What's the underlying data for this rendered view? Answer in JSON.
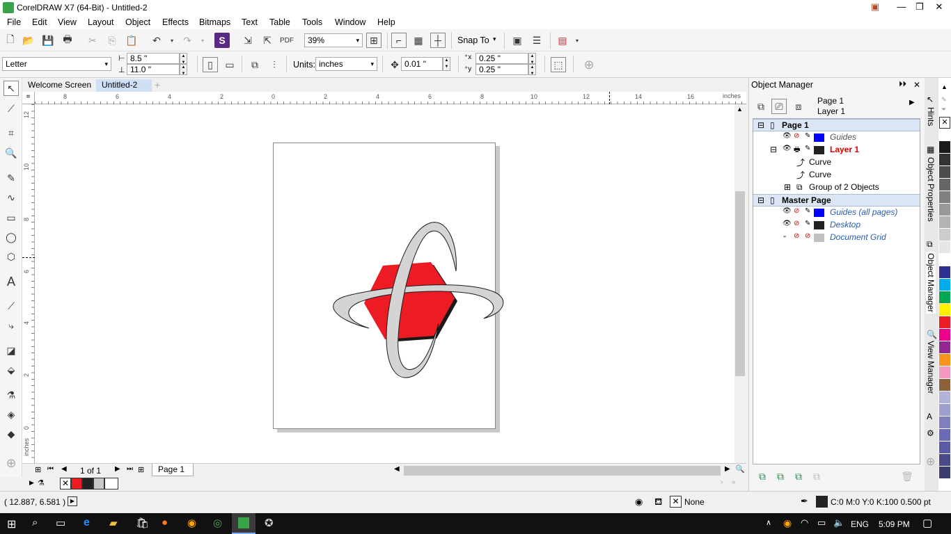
{
  "window": {
    "title": "CorelDRAW X7 (64-Bit) - Untitled-2"
  },
  "menu": [
    "File",
    "Edit",
    "View",
    "Layout",
    "Object",
    "Effects",
    "Bitmaps",
    "Text",
    "Table",
    "Tools",
    "Window",
    "Help"
  ],
  "toolbar": {
    "zoom": "39%",
    "snap_to": "Snap To"
  },
  "property_bar": {
    "page_size": "Letter",
    "width": "8.5 \"",
    "height": "11.0 \"",
    "units_label": "Units:",
    "units": "inches",
    "nudge": "0.01 \"",
    "dup_x": "0.25 \"",
    "dup_y": "0.25 \""
  },
  "doc_tabs": [
    "Welcome Screen",
    "Untitled-2"
  ],
  "ruler": {
    "h_labels": [
      "8",
      "6",
      "4",
      "2",
      "0",
      "2",
      "4",
      "6",
      "8",
      "10",
      "12",
      "14",
      "16"
    ],
    "h_unit": "inches",
    "v_labels": [
      "12",
      "10",
      "8",
      "6",
      "4",
      "2",
      "0"
    ],
    "v_unit": "inches"
  },
  "page_nav": {
    "page_count": "1 of 1",
    "page_tab": "Page 1"
  },
  "status": {
    "coords": "( 12.887, 6.581 )",
    "fill": "None",
    "outline": "C:0 M:0 Y:0 K:100  0.500 pt"
  },
  "object_manager": {
    "title": "Object Manager",
    "current_page": "Page 1",
    "current_layer": "Layer 1",
    "tree": [
      {
        "label": "Page 1",
        "kind": "page"
      },
      {
        "label": "Guides",
        "kind": "layer",
        "color": "#0000ff",
        "style": "italic"
      },
      {
        "label": "Layer 1",
        "kind": "layer",
        "color": "#222222",
        "style": "red-bold"
      },
      {
        "label": "Curve",
        "kind": "object"
      },
      {
        "label": "Curve",
        "kind": "object"
      },
      {
        "label": "Group of 2 Objects",
        "kind": "group"
      },
      {
        "label": "Master Page",
        "kind": "page"
      },
      {
        "label": "Guides (all pages)",
        "kind": "layer",
        "color": "#0000ff",
        "style": "italic"
      },
      {
        "label": "Desktop",
        "kind": "layer",
        "color": "#222222",
        "style": "italic"
      },
      {
        "label": "Document Grid",
        "kind": "layer",
        "color": "#c0c0c0",
        "style": "italic"
      }
    ]
  },
  "docker_tabs": [
    "Hints",
    "Object Properties",
    "Object Manager",
    "View Manager"
  ],
  "taskbar": {
    "lang": "ENG",
    "time": "5:09 PM"
  },
  "colors": {
    "logo_red": "#ed1c24",
    "ring_gray": "#d4d4d4",
    "palette": [
      "#ffffff",
      "#1a1a1a",
      "#333333",
      "#4d4d4d",
      "#666666",
      "#808080",
      "#999999",
      "#b3b3b3",
      "#cccccc",
      "#e6e6e6",
      "#ffffff",
      "#2e3192",
      "#00aeef",
      "#00a651",
      "#fff200",
      "#ed1c24",
      "#ec008c",
      "#92278f",
      "#f7941d",
      "#f49ac1",
      "#8c6239",
      "#b3b3d9",
      "#9e9ecf",
      "#7f7fbf",
      "#6b6bb5",
      "#5a5aa5",
      "#4a4a8a",
      "#3c3c70"
    ]
  }
}
